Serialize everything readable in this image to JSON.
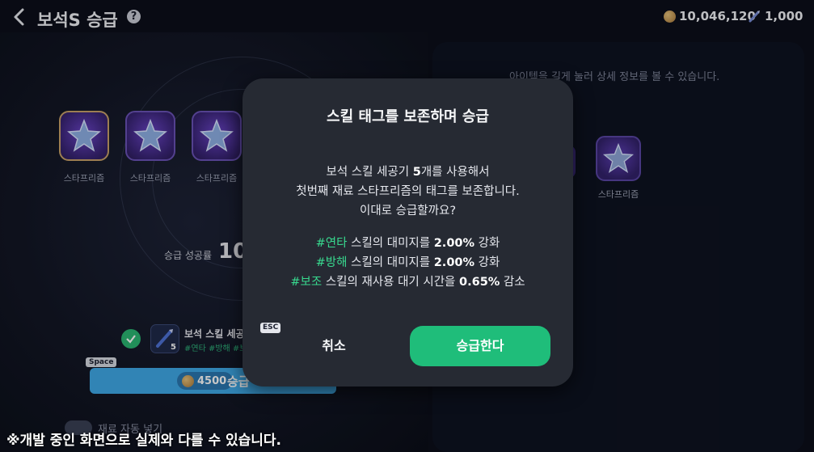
{
  "header": {
    "title": "보석S 승급",
    "help_glyph": "?",
    "coins": "10,046,120",
    "chisels": "1,000"
  },
  "left_panel": {
    "slots": [
      {
        "label": "스타프리즘"
      },
      {
        "label": "스타프리즘"
      },
      {
        "label": "스타프리즘"
      }
    ],
    "success_rate_label": "승급 성공률",
    "success_rate_value": "10",
    "material": {
      "name": "보석 스킬 세공",
      "count": "5",
      "tags": "#연타 #방해 #보조"
    },
    "space_key": "Space",
    "upgrade_button": {
      "cost": "4500",
      "label": "승급"
    },
    "auto_label": "재료 자동 넣기"
  },
  "right_panel": {
    "hint": "아이템을 길게 눌러 상세 정보를 볼 수 있습니다.",
    "item_label": "스타프리즘"
  },
  "dev_note": "※개발 중인 화면으로 실제와 다를 수 있습니다.",
  "modal": {
    "title": "스킬 태그를 보존하며 승급",
    "line1_pre": "보석 스킬 세공기 ",
    "line1_num": "5",
    "line1_post": "개를 사용해서",
    "line2": "첫번째 재료 스타프리즘의 태그를 보존합니다.",
    "line3": "이대로 승급할까요?",
    "effects": [
      {
        "tag": "#연타",
        "pre": " 스킬의 대미지를 ",
        "value": "2.00%",
        "post": " 강화"
      },
      {
        "tag": "#방해",
        "pre": " 스킬의 대미지를 ",
        "value": "2.00%",
        "post": " 강화"
      },
      {
        "tag": "#보조",
        "pre": " 스킬의 재사용 대기 시간을 ",
        "value": "0.65%",
        "post": " 감소"
      }
    ],
    "esc_key": "ESC",
    "cancel_label": "취소",
    "confirm_label": "승급한다"
  },
  "colors": {
    "accent_green": "#1fbd7a",
    "tag_green": "#38d98f",
    "upgrade_blue": "#3fa9e8",
    "modal_bg": "#262a33"
  }
}
